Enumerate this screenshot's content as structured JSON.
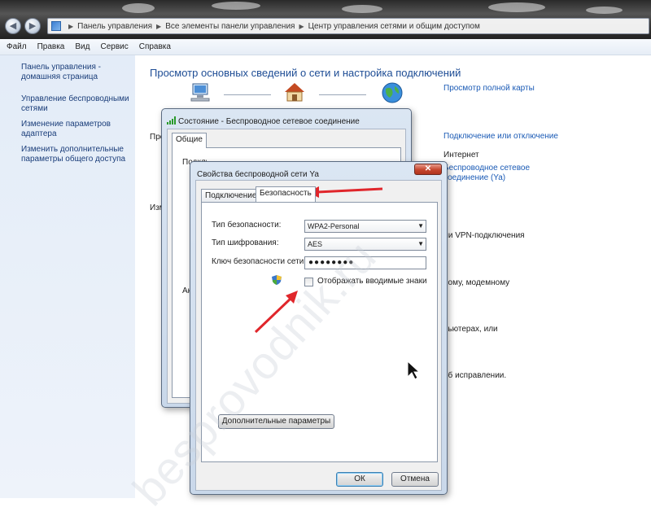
{
  "address": {
    "crumbs": [
      "Панель управления",
      "Все элементы панели управления",
      "Центр управления сетями и общим доступом"
    ]
  },
  "menu": [
    "Файл",
    "Правка",
    "Вид",
    "Сервис",
    "Справка"
  ],
  "sidebar": {
    "items": [
      {
        "label": "Панель управления - домашняя страница"
      },
      {
        "label": "Управление беспроводными сетями"
      },
      {
        "label": "Изменение параметров адаптера"
      },
      {
        "label": "Изменить дополнительные параметры общего доступа"
      }
    ]
  },
  "main": {
    "title": "Просмотр основных сведений о сети и настройка подключений",
    "full_map_link": "Просмотр полной карты",
    "connect_link": "Подключение или отключение",
    "internet_label": "Интернет",
    "wireless_link": "Беспроводное сетевое соединение (Ya)",
    "side_fragments": [
      "Про",
      "Изм",
      "Акт"
    ],
    "text_vpn": "ли VPN-подключения",
    "text_modem": "ному, модемному",
    "text_computers": "пьютерах, или",
    "text_fix": "об исправлении."
  },
  "status_dialog": {
    "title": "Состояние - Беспроводное сетевое соединение",
    "tab": "Общие",
    "fragment": "Подключение"
  },
  "props_dialog": {
    "title": "Свойства беспроводной сети Ya",
    "close_glyph": "✕",
    "tabs": [
      "Подключение",
      "Безопасность"
    ],
    "security_type_label": "Тип безопасности:",
    "security_type_value": "WPA2-Personal",
    "encryption_label": "Тип шифрования:",
    "encryption_value": "AES",
    "key_label": "Ключ безопасности сети",
    "key_value": "●●●●●●●●",
    "show_chars_label": "Отображать вводимые знаки",
    "show_chars_checked": false,
    "advanced_button": "Дополнительные параметры",
    "ok_button": "ОК",
    "cancel_button": "Отмена"
  },
  "watermark": "besprovodnik.ru",
  "colors": {
    "annotation_arrow": "#e0262b",
    "link": "#1a5ab5"
  }
}
